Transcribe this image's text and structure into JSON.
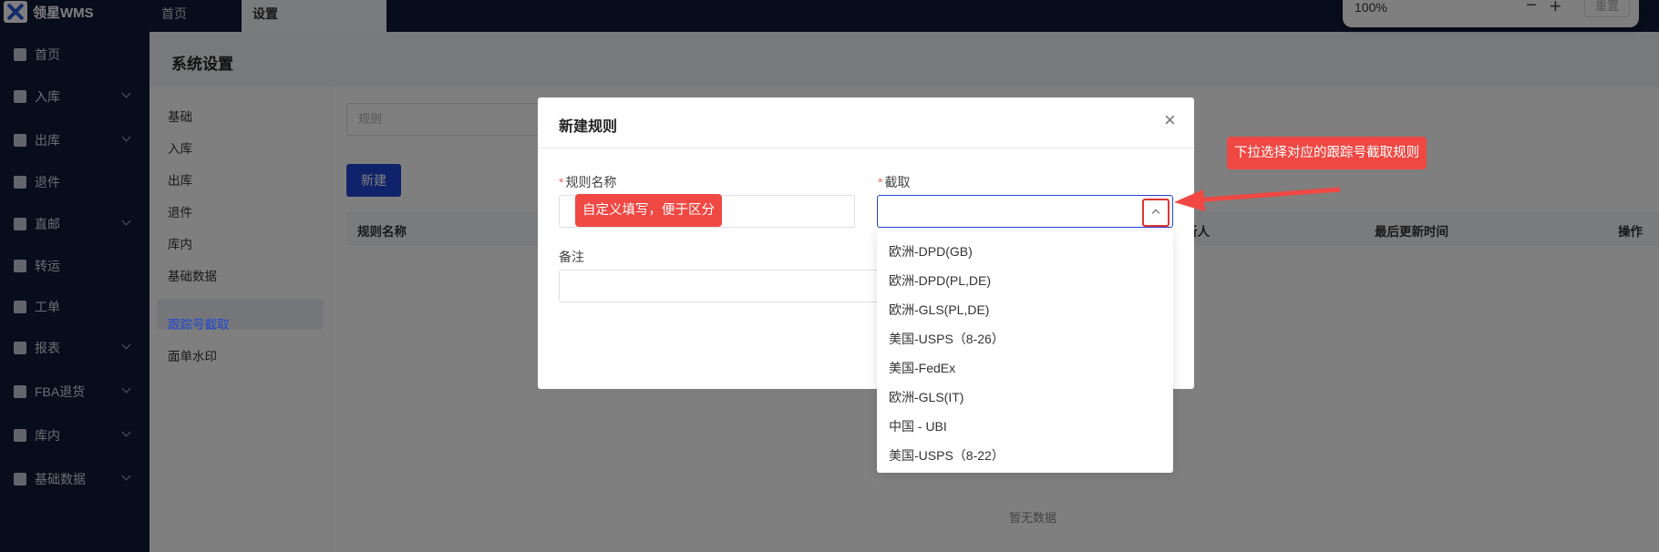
{
  "app": {
    "name": "领星WMS"
  },
  "top_tabs": [
    {
      "label": "首页"
    },
    {
      "label": "设置"
    }
  ],
  "zoom": {
    "value": "100%",
    "minus": "−",
    "plus": "+",
    "reset": "重置"
  },
  "sidebar": {
    "items": [
      {
        "label": "首页",
        "icon": "home-icon"
      },
      {
        "label": "入库",
        "icon": "inbound-icon"
      },
      {
        "label": "出库",
        "icon": "outbound-icon"
      },
      {
        "label": "退件",
        "icon": "return-icon"
      },
      {
        "label": "直邮",
        "icon": "direct-mail-icon"
      },
      {
        "label": "转运",
        "icon": "transfer-icon"
      },
      {
        "label": "工单",
        "icon": "ticket-icon"
      },
      {
        "label": "报表",
        "icon": "report-icon"
      },
      {
        "label": "FBA退货",
        "icon": "amazon-icon"
      },
      {
        "label": "库内",
        "icon": "warehouse-icon"
      },
      {
        "label": "基础数据",
        "icon": "data-icon"
      }
    ]
  },
  "page": {
    "title": "系统设置"
  },
  "subnav": {
    "items": [
      {
        "label": "基础"
      },
      {
        "label": "入库"
      },
      {
        "label": "出库"
      },
      {
        "label": "退件"
      },
      {
        "label": "库内"
      },
      {
        "label": "基础数据"
      },
      {
        "label": "跟踪号截取"
      },
      {
        "label": "面单水印"
      }
    ]
  },
  "list": {
    "search_placeholder": "规则",
    "new_button": "新建",
    "columns": [
      "规则名称",
      "新人",
      "最后更新时间",
      "操作"
    ],
    "empty": "暂无数据"
  },
  "modal": {
    "title": "新建规则",
    "close": "×",
    "required_mark": "*",
    "name_label": "规则名称",
    "intercept_label": "截取",
    "remark_label": "备注"
  },
  "dropdown": {
    "options": [
      "欧洲-DPD(GB)",
      "欧洲-DPD(PL,DE)",
      "欧洲-GLS(PL,DE)",
      "美国-USPS（8-26）",
      "美国-FedEx",
      "欧洲-GLS(IT)",
      "中国 - UBI",
      "美国-USPS（8-22）"
    ]
  },
  "annotations": {
    "name_hint": "自定义填写，便于区分",
    "intercept_hint": "下拉选择对应的跟踪号截取规则"
  },
  "colors": {
    "brand_dark": "#0e1a36",
    "primary": "#2146d4",
    "callout": "#f04843"
  }
}
